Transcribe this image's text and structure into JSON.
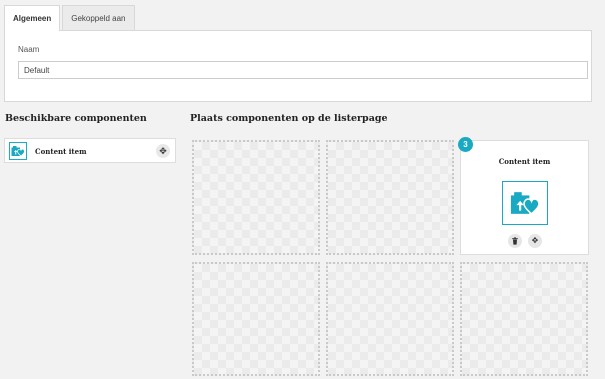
{
  "tabs": [
    {
      "label": "Algemeen",
      "active": true
    },
    {
      "label": "Gekoppeld aan",
      "active": false
    }
  ],
  "form": {
    "name_label": "Naam",
    "name_value": "Default"
  },
  "available": {
    "heading": "Beschikbare componenten",
    "items": [
      {
        "label": "Content item",
        "icon": "content-item-icon",
        "action_icon": "move-icon"
      }
    ]
  },
  "layout": {
    "heading": "Plaats componenten op de listerpage",
    "placed": {
      "position_badge": "3",
      "title": "Content item",
      "icon": "content-item-icon",
      "actions": [
        "trash-icon",
        "move-icon"
      ]
    }
  },
  "colors": {
    "accent": "#19a9c3",
    "background": "#f2f2f2",
    "panel": "#ffffff"
  }
}
